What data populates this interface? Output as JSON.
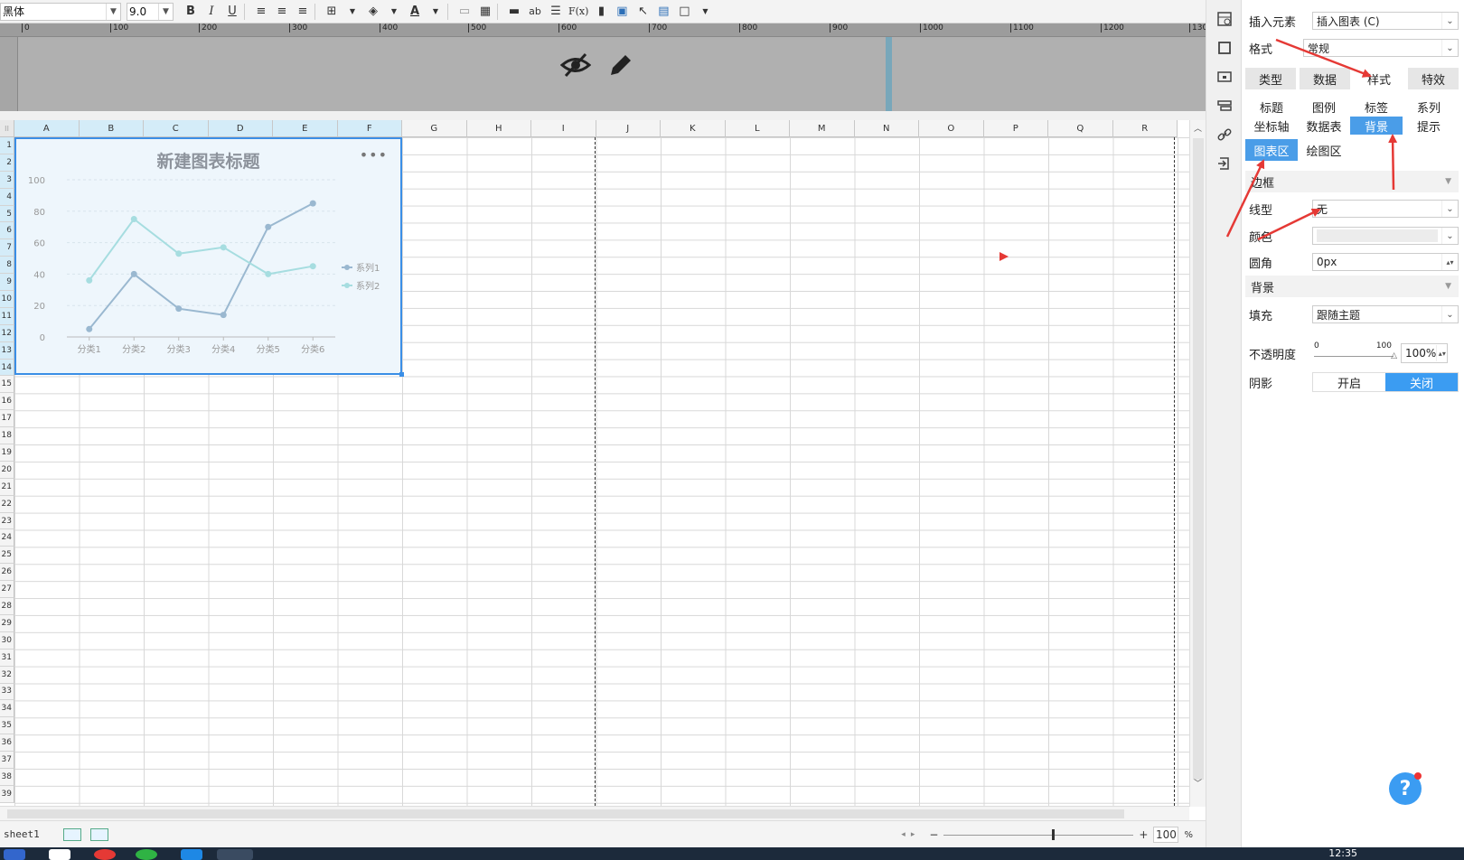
{
  "toolbar": {
    "font_name": "黑体",
    "font_size": "9.0",
    "icons": [
      "bold-icon",
      "italic-icon",
      "underline-icon",
      "align-left-icon",
      "align-center-icon",
      "align-right-icon",
      "border-icon",
      "fill-color-icon",
      "font-color-icon",
      "merge-icon",
      "table-icon",
      "link-icon",
      "text-icon",
      "wrap-icon",
      "formula-icon",
      "chart-icon",
      "image-icon",
      "brush-icon",
      "report-icon",
      "frame-icon"
    ],
    "bold": "B",
    "italic": "I",
    "underline": "U",
    "formula": "F(x)",
    "ab": "ab",
    "font_color": "A"
  },
  "ruler": {
    "ticks": [
      "0",
      "100",
      "200",
      "300",
      "400",
      "500",
      "600",
      "700",
      "800",
      "900",
      "1000",
      "1100",
      "1200",
      "130"
    ]
  },
  "header_icons": [
    "hide-icon",
    "edit-icon"
  ],
  "grid": {
    "columns": [
      "A",
      "B",
      "C",
      "D",
      "E",
      "F",
      "G",
      "H",
      "I",
      "J",
      "K",
      "L",
      "M",
      "N",
      "O",
      "P",
      "Q",
      "R"
    ],
    "selected_columns": [
      "A",
      "B",
      "C",
      "D",
      "E",
      "F"
    ],
    "rows": [
      "1",
      "2",
      "3",
      "4",
      "5",
      "6",
      "7",
      "8",
      "9",
      "10",
      "11",
      "12",
      "13",
      "14",
      "15",
      "16",
      "17",
      "18",
      "19",
      "20",
      "21",
      "22",
      "23",
      "24",
      "25",
      "26",
      "27",
      "28",
      "29",
      "30",
      "31",
      "32",
      "33",
      "34",
      "35",
      "36",
      "37",
      "38",
      "39"
    ],
    "selected_row_count": 14
  },
  "chart": {
    "title": "新建图表标题",
    "more": "•••"
  },
  "chart_data": {
    "type": "line",
    "title": "新建图表标题",
    "categories": [
      "分类1",
      "分类2",
      "分类3",
      "分类4",
      "分类5",
      "分类6"
    ],
    "series": [
      {
        "name": "系列1",
        "values": [
          5,
          40,
          18,
          14,
          70,
          85
        ],
        "color": "#9ab8d0"
      },
      {
        "name": "系列2",
        "values": [
          36,
          75,
          53,
          57,
          40,
          45
        ],
        "color": "#a6dde0"
      }
    ],
    "yticks": [
      "0",
      "20",
      "40",
      "60",
      "80",
      "100"
    ],
    "ylim": [
      0,
      100
    ],
    "grid": true,
    "legend": "right"
  },
  "sheetbar": {
    "sheet_name": "sheet1",
    "zoom_minus": "−",
    "zoom_plus": "+",
    "zoom_value": "100",
    "zoom_unit": "%"
  },
  "taskbar": {
    "clock": "12:35"
  },
  "panel": {
    "insert_label": "插入元素",
    "insert_value": "插入图表 (C)",
    "format_label": "格式",
    "format_value": "常规",
    "tabs": [
      "类型",
      "数据",
      "样式",
      "特效"
    ],
    "active_tab": "样式",
    "style_row1": [
      "标题",
      "图例",
      "标签",
      "系列"
    ],
    "style_row2": [
      "坐标轴",
      "数据表",
      "背景",
      "提示"
    ],
    "style_row3": [
      "图表区",
      "绘图区"
    ],
    "border_section": "边框",
    "line_type_label": "线型",
    "line_type_value": "无",
    "color_label": "颜色",
    "radius_label": "圆角",
    "radius_value": "0px",
    "background_section": "背景",
    "fill_label": "填充",
    "fill_value": "跟随主题",
    "opacity_label": "不透明度",
    "opacity_min": "0",
    "opacity_max": "100",
    "opacity_value": "100%",
    "shadow_label": "阴影",
    "shadow_on": "开启",
    "shadow_off": "关闭"
  },
  "help": "?",
  "colors": {
    "accent": "#3b9cf2",
    "arrow": "#e53935",
    "chart_border": "#3a8ee6"
  }
}
